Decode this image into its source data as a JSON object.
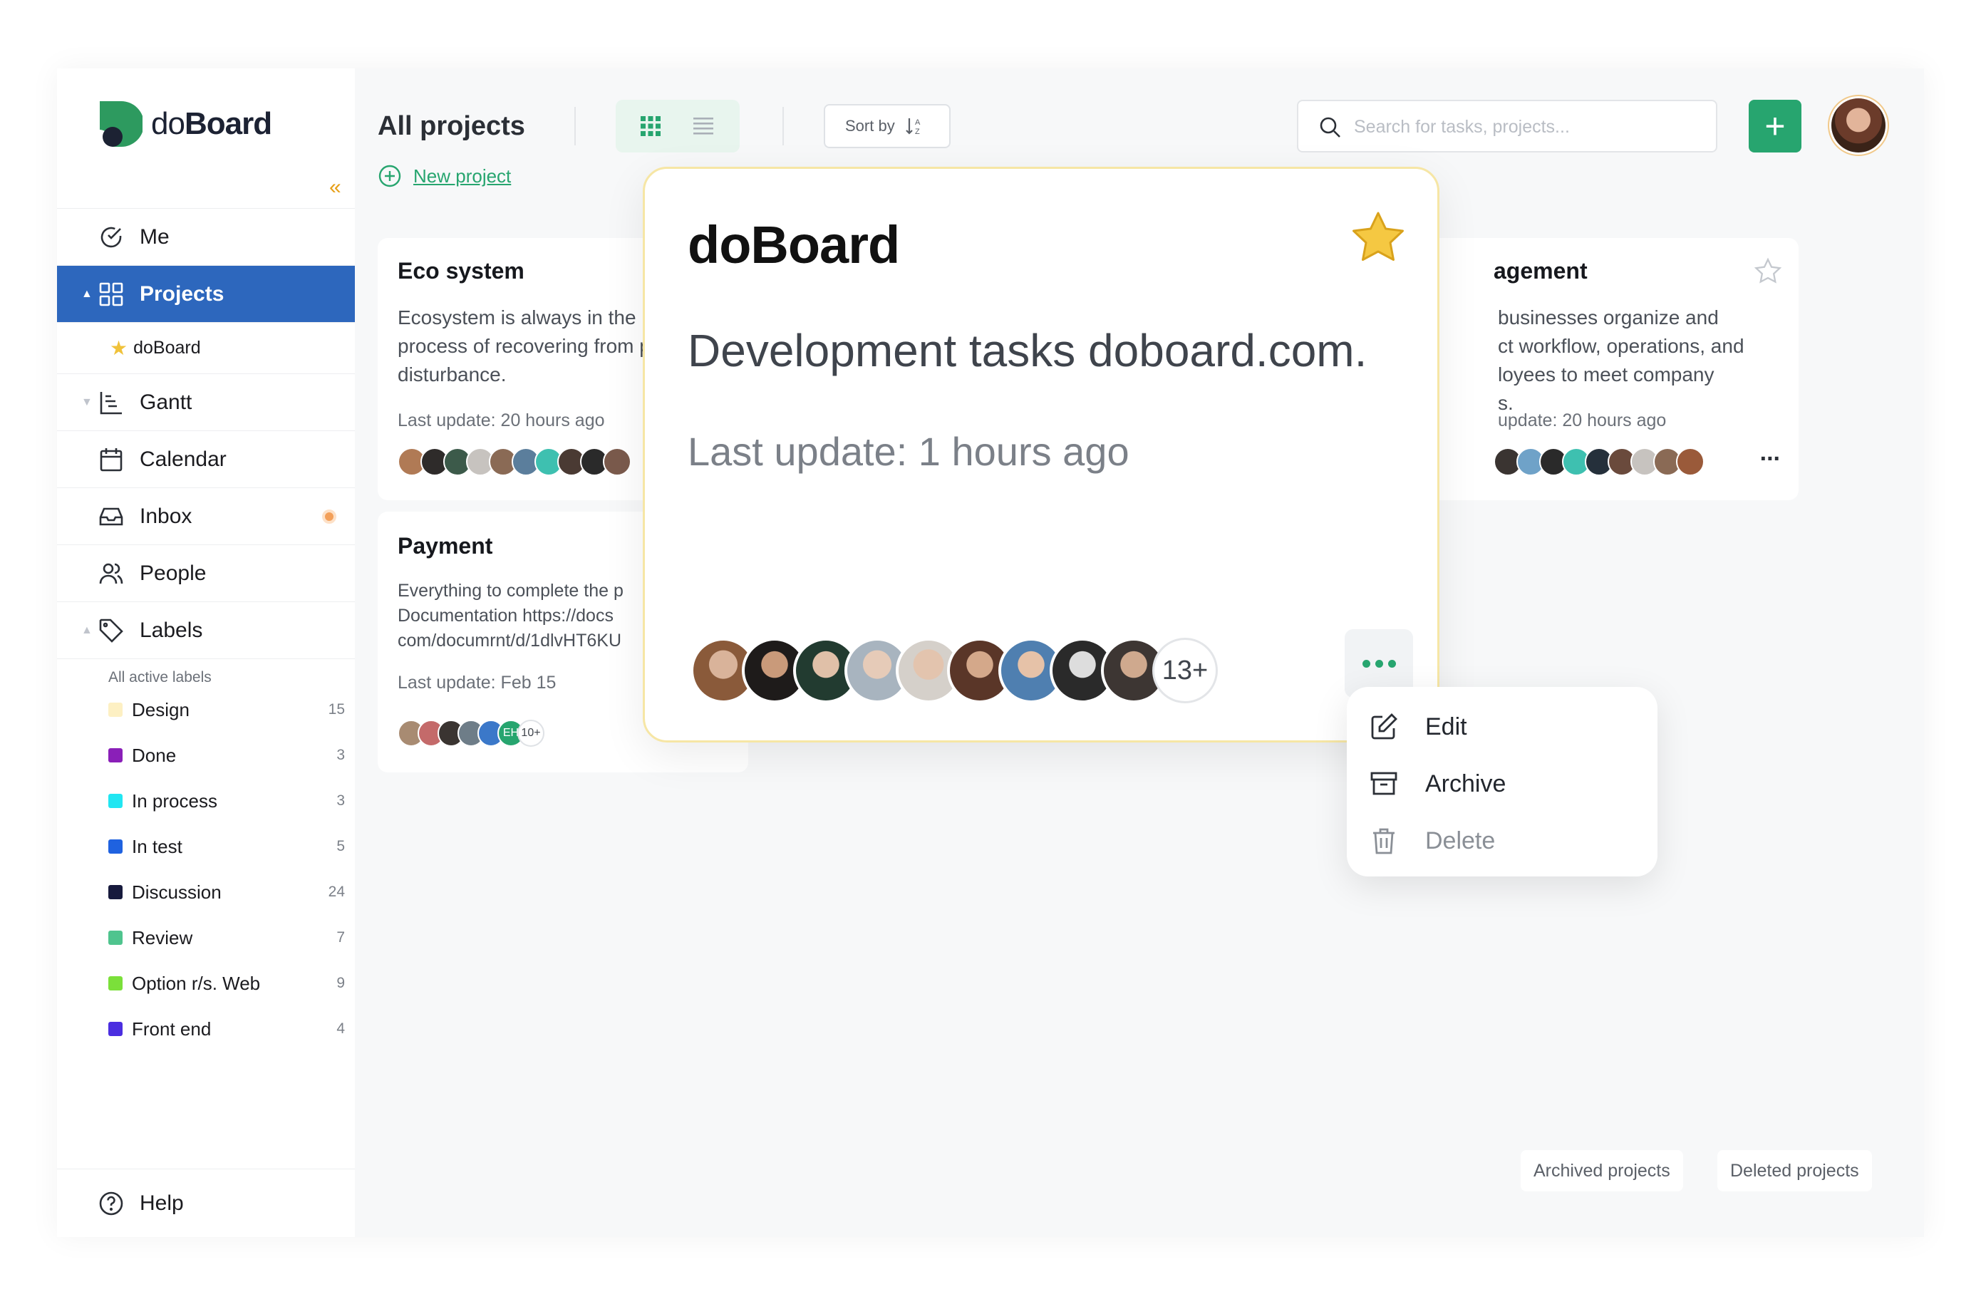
{
  "app": {
    "logo_text_light": "do",
    "logo_text_bold": "Board"
  },
  "sidebar": {
    "collapse_glyph": "«",
    "items": [
      {
        "label": "Me",
        "icon": "check-circle-icon"
      },
      {
        "label": "Projects",
        "icon": "grid-icon",
        "active": true
      },
      {
        "label": "Gantt",
        "icon": "gantt-icon"
      },
      {
        "label": "Calendar",
        "icon": "calendar-icon"
      },
      {
        "label": "Inbox",
        "icon": "inbox-icon",
        "has_notification": true
      },
      {
        "label": "People",
        "icon": "people-icon"
      },
      {
        "label": "Labels",
        "icon": "tag-icon"
      }
    ],
    "favorite_project": "doBoard",
    "labels_heading": "All active labels",
    "labels": [
      {
        "name": "Design",
        "count": "15",
        "color": "#fdf0c3"
      },
      {
        "name": "Done",
        "count": "3",
        "color": "#8a1fb8"
      },
      {
        "name": "In process",
        "count": "3",
        "color": "#21e6f2"
      },
      {
        "name": "In test",
        "count": "5",
        "color": "#1f62e0"
      },
      {
        "name": "Discussion",
        "count": "24",
        "color": "#171a3d"
      },
      {
        "name": "Review",
        "count": "7",
        "color": "#4fc48e"
      },
      {
        "name": "Option r/s. Web",
        "count": "9",
        "color": "#7be03a"
      },
      {
        "name": "Front end",
        "count": "4",
        "color": "#4b2ee0"
      }
    ],
    "help": "Help"
  },
  "header": {
    "title": "All projects",
    "sort_label": "Sort by",
    "search_placeholder": "Search for tasks, projects...",
    "new_project": "New project",
    "add_glyph": "+"
  },
  "cards": {
    "eco": {
      "title": "Eco system",
      "desc": "Ecosystem is always in the process of recovering from past disturbance.",
      "update": "Last update: 20 hours ago"
    },
    "payment": {
      "title": "Payment",
      "desc_1": "Everything to complete the p",
      "desc_2": "Documentation https://docs",
      "desc_3": "com/documrnt/d/1dlvHT6KU",
      "update": "Last update: Feb 15",
      "initials": "EH",
      "more": "10+"
    },
    "mgmt": {
      "title": "agement",
      "desc_1": "businesses organize and",
      "desc_2": "ct workflow, operations, and",
      "desc_3": "loyees to meet company",
      "desc_4": "s.",
      "update": "update: 20 hours ago",
      "more_glyph": "..."
    }
  },
  "featured": {
    "title": "doBoard",
    "description": "Development tasks doboard.com.",
    "update": "Last update: 1 hours ago",
    "more_members": "13+"
  },
  "context_menu": {
    "edit": "Edit",
    "archive": "Archive",
    "delete": "Delete"
  },
  "footer": {
    "archived": "Archived projects",
    "deleted": "Deleted projects"
  },
  "colors": {
    "brand_green": "#27a56f",
    "active_blue": "#2d67bd",
    "star_yellow": "#f5c842"
  }
}
